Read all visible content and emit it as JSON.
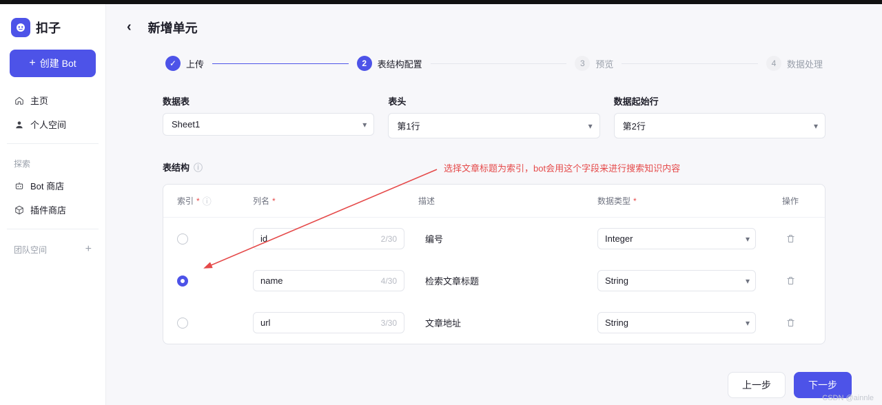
{
  "brand": {
    "name": "扣子"
  },
  "sidebar": {
    "create_label": "创建 Bot",
    "nav": [
      {
        "label": "主页",
        "icon": "home-icon"
      },
      {
        "label": "个人空间",
        "icon": "user-icon"
      }
    ],
    "groups": {
      "explore_label": "探索",
      "team_label": "团队空间",
      "explore_items": [
        {
          "label": "Bot 商店",
          "icon": "bot-store-icon"
        },
        {
          "label": "插件商店",
          "icon": "plugin-store-icon"
        }
      ]
    }
  },
  "header": {
    "title": "新增单元"
  },
  "steps": [
    {
      "state": "done",
      "label": "上传",
      "mark": "✓"
    },
    {
      "state": "active",
      "label": "表结构配置",
      "mark": "2"
    },
    {
      "state": "idle",
      "label": "预览",
      "mark": "3"
    },
    {
      "state": "idle",
      "label": "数据处理",
      "mark": "4"
    }
  ],
  "config": {
    "data_table": {
      "label": "数据表",
      "value": "Sheet1"
    },
    "header_row": {
      "label": "表头",
      "value": "第1行"
    },
    "start_row": {
      "label": "数据起始行",
      "value": "第2行"
    }
  },
  "structure": {
    "title": "表结构",
    "headers": {
      "index": "索引",
      "col": "列名",
      "desc": "描述",
      "type": "数据类型",
      "op": "操作"
    },
    "rows": [
      {
        "selected": false,
        "name": "id",
        "count": "2/30",
        "desc": "编号",
        "type": "Integer"
      },
      {
        "selected": true,
        "name": "name",
        "count": "4/30",
        "desc": "检索文章标题",
        "type": "String"
      },
      {
        "selected": false,
        "name": "url",
        "count": "3/30",
        "desc": "文章地址",
        "type": "String"
      }
    ]
  },
  "annotation": "选择文章标题为索引，bot会用这个字段来进行搜索知识内容",
  "footer": {
    "prev": "上一步",
    "next": "下一步"
  },
  "watermark": "CSDN @ainnle"
}
